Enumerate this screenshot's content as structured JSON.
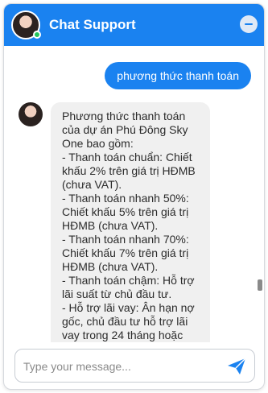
{
  "header": {
    "title": "Chat Support",
    "minimize_icon": "minus-icon",
    "status": "online"
  },
  "messages": [
    {
      "sender": "user",
      "text": "phương thức thanh toán"
    },
    {
      "sender": "bot",
      "lines": [
        "Phương thức thanh toán của dự án Phú Đông Sky One bao gồm:",
        "- Thanh toán chuẩn: Chiết khấu 2% trên giá trị HĐMB (chưa VAT).",
        "- Thanh toán nhanh 50%: Chiết khấu 5% trên giá trị HĐMB (chưa VAT).",
        "- Thanh toán nhanh 70%: Chiết khấu 7% trên giá trị HĐMB (chưa VAT).",
        "- Thanh toán chậm: Hỗ trợ lãi suất từ chủ đầu tư.",
        "- Hỗ trợ lãi vay: Ân hạn nợ gốc, chủ đầu tư hỗ trợ lãi vay trong 24 tháng hoặc"
      ]
    }
  ],
  "input": {
    "placeholder": "Type your message...",
    "value": ""
  },
  "send_icon": "paper-plane-icon",
  "colors": {
    "accent": "#1a82f0",
    "bot_bubble": "#f0f0f0",
    "status_online": "#22c55e"
  }
}
